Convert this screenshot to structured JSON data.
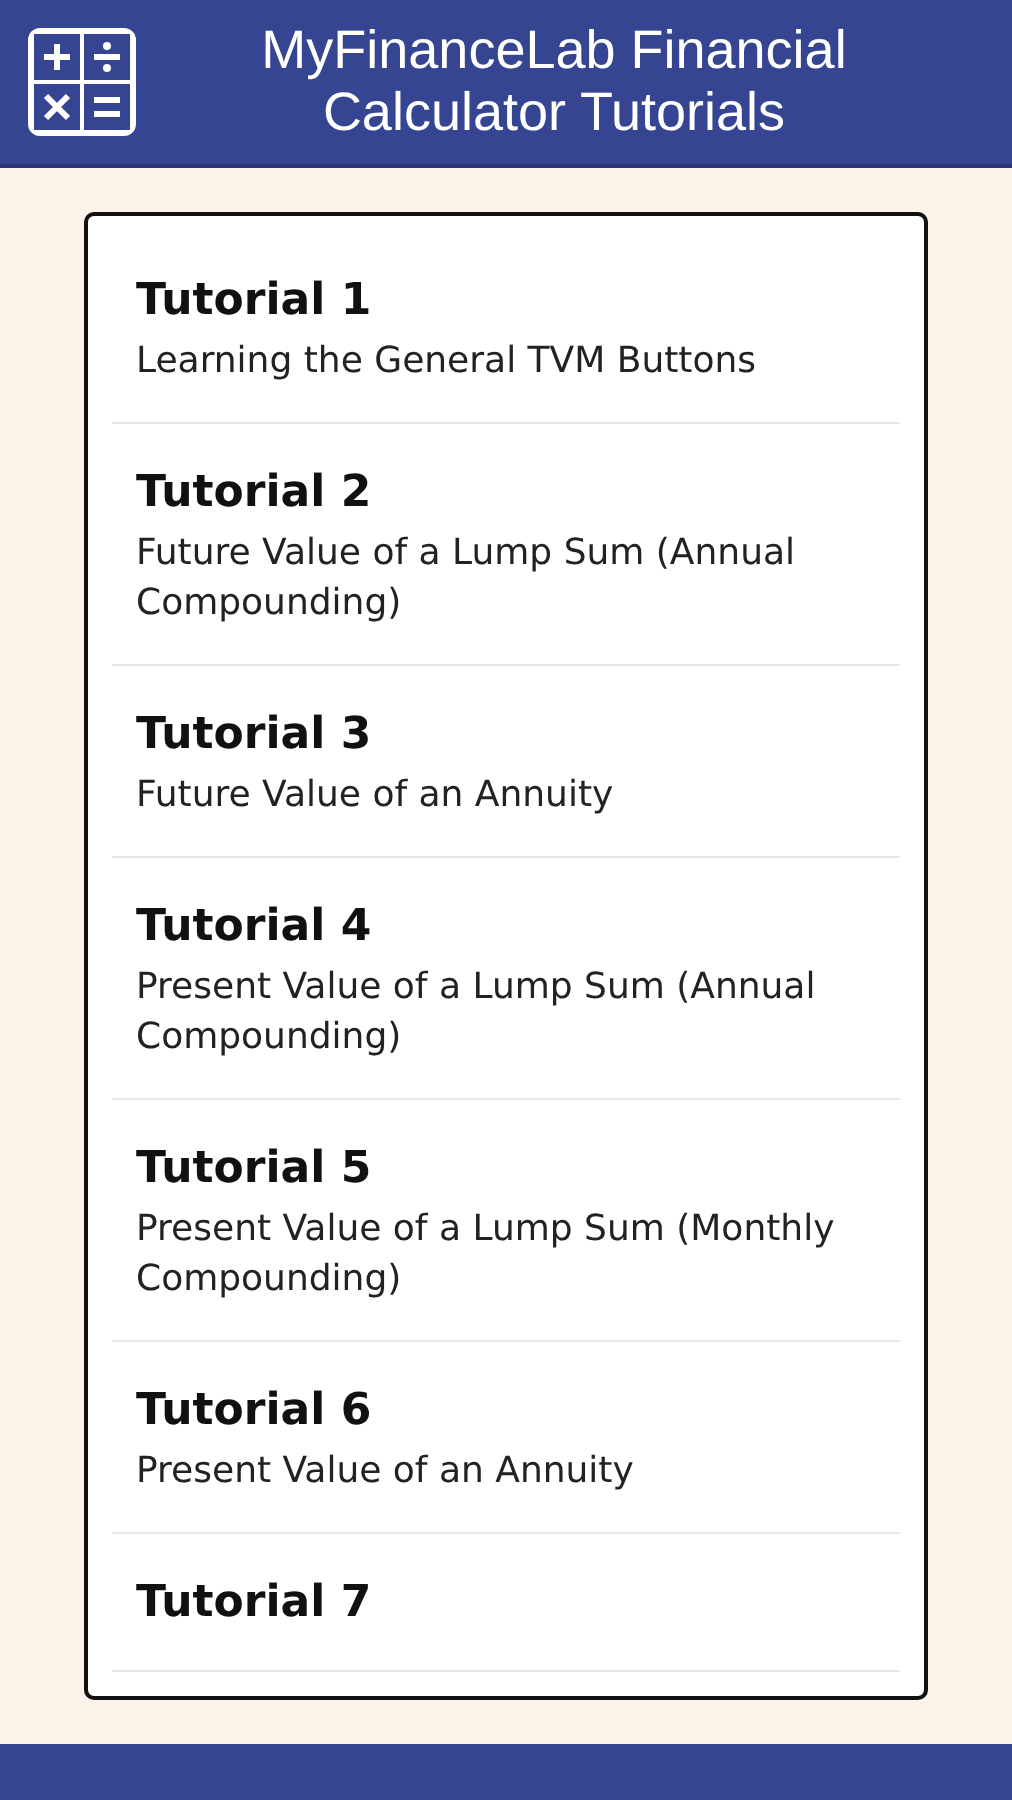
{
  "header": {
    "title": "MyFinanceLab Financial Calculator Tutorials"
  },
  "tutorials": [
    {
      "title": "Tutorial 1",
      "subtitle": "Learning the General TVM Buttons"
    },
    {
      "title": "Tutorial 2",
      "subtitle": "Future Value of a Lump Sum (Annual Compounding)"
    },
    {
      "title": "Tutorial 3",
      "subtitle": "Future Value of an Annuity"
    },
    {
      "title": "Tutorial 4",
      "subtitle": "Present Value of a Lump Sum (Annual Compounding)"
    },
    {
      "title": "Tutorial 5",
      "subtitle": "Present Value of a Lump Sum (Monthly Compounding)"
    },
    {
      "title": "Tutorial 6",
      "subtitle": "Present Value of an Annuity"
    },
    {
      "title": "Tutorial 7"
    }
  ]
}
